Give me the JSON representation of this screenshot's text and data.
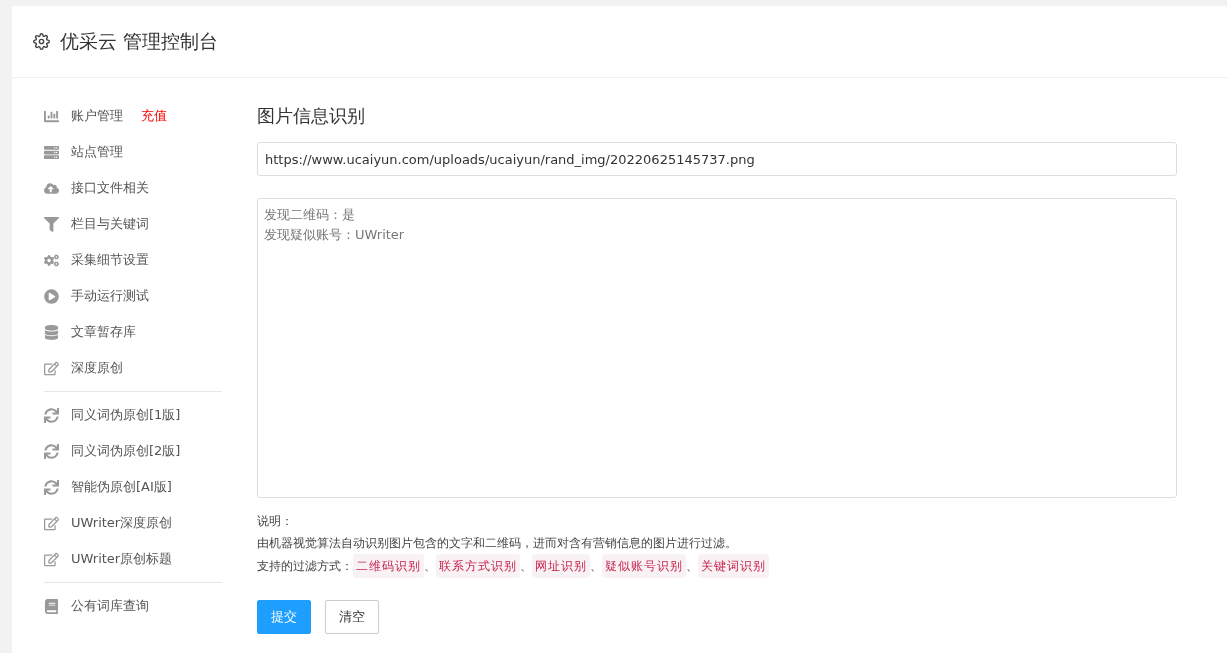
{
  "header": {
    "title": "优采云 管理控制台"
  },
  "sidebar": {
    "groups": [
      {
        "items": [
          {
            "label": "账户管理",
            "badge": "充值"
          },
          {
            "label": "站点管理"
          },
          {
            "label": "接口文件相关"
          },
          {
            "label": "栏目与关键词"
          },
          {
            "label": "采集细节设置"
          },
          {
            "label": "手动运行测试"
          },
          {
            "label": "文章暂存库"
          },
          {
            "label": "深度原创"
          }
        ]
      },
      {
        "items": [
          {
            "label": "同义词伪原创[1版]"
          },
          {
            "label": "同义词伪原创[2版]"
          },
          {
            "label": "智能伪原创[AI版]"
          },
          {
            "label": "UWriter深度原创"
          },
          {
            "label": "UWriter原创标题"
          }
        ]
      },
      {
        "items": [
          {
            "label": "公有词库查询"
          }
        ]
      }
    ]
  },
  "main": {
    "heading": "图片信息识别",
    "url_field": {
      "value": "https://www.ucaiyun.com/uploads/ucaiyun/rand_img/20220625145737.png"
    },
    "result_box": {
      "lines": [
        "发现二维码：是",
        "发现疑似账号：UWriter"
      ]
    },
    "notes": {
      "title": "说明：",
      "description": "由机器视觉算法自动识别图片包含的文字和二维码，进而对含有营销信息的图片进行过滤。",
      "methods_label": "支持的过滤方式：",
      "methods": [
        {
          "label": "二维码识别",
          "separator": "、"
        },
        {
          "label": "联系方式识别",
          "separator": "、"
        },
        {
          "label": "网址识别",
          "separator": "、"
        },
        {
          "label": "疑似账号识别",
          "separator": "、"
        },
        {
          "label": "关键词识别"
        }
      ]
    },
    "buttons": [
      {
        "label": "提交",
        "kind": "primary"
      },
      {
        "label": "清空",
        "kind": "plain"
      }
    ]
  }
}
